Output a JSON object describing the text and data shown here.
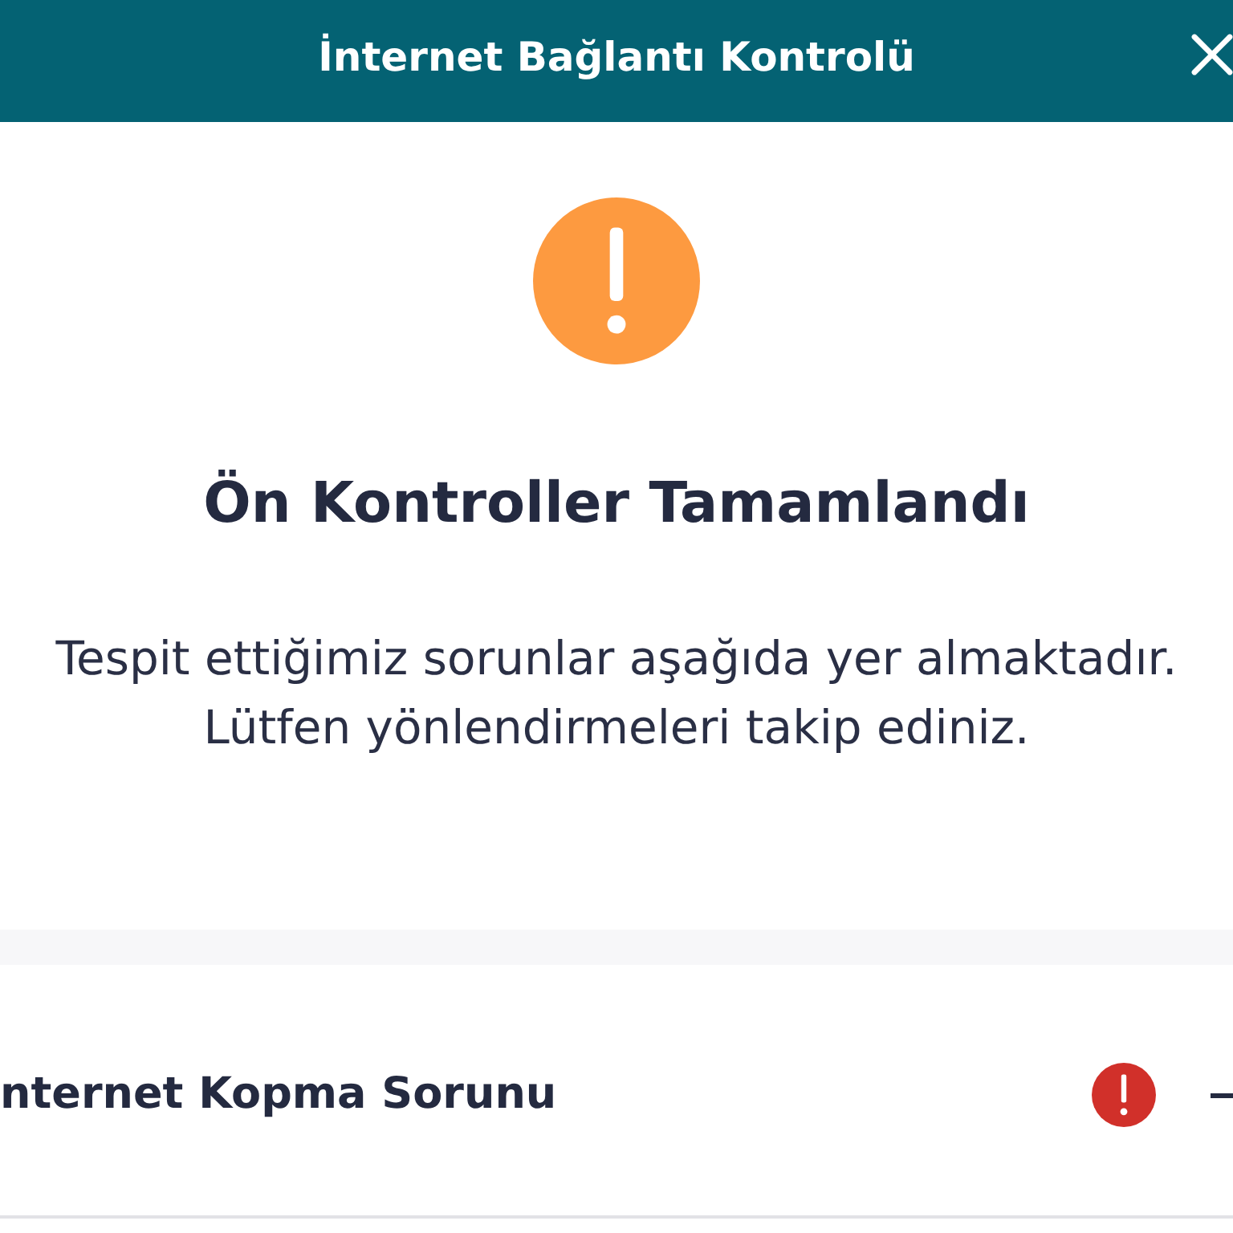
{
  "window": {
    "title": "İnternet Bağlantı Kontrolü"
  },
  "result": {
    "kind": "warning",
    "title": "Ön Kontroller Tamamlandı",
    "message": "Tespit ettiğimiz sorunlar aşağıda yer almaktadır.\nLütfen yönlendirmeleri takip ediniz."
  },
  "issues": [
    {
      "label": "nternet Kopma Sorunu",
      "kind": "error",
      "expanded": true
    }
  ]
}
